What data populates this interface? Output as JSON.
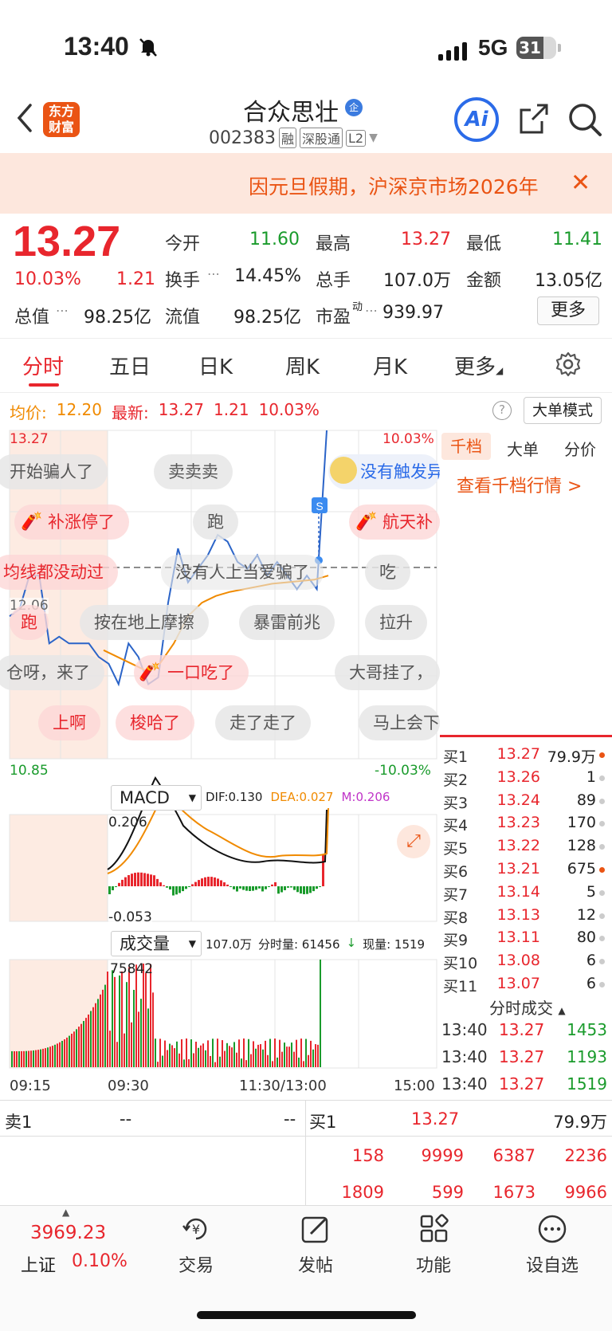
{
  "status": {
    "time": "13:40",
    "network": "5G",
    "battery": "31"
  },
  "header": {
    "logo": "东方财富",
    "stock_name": "合众思壮",
    "badge": "企",
    "code": "002383",
    "tags": [
      "融",
      "深股通",
      "L2"
    ],
    "ai": "Ai"
  },
  "notice": {
    "text": "因元旦假期，沪深京市场2026年",
    "close": "✕"
  },
  "quote": {
    "price": "13.27",
    "pct": "10.03%",
    "change": "1.21",
    "open_label": "今开",
    "open": "11.60",
    "high_label": "最高",
    "high": "13.27",
    "low_label": "最低",
    "low": "11.41",
    "turnover_label": "换手",
    "turnover": "14.45%",
    "volume_label": "总手",
    "volume": "107.0万",
    "amount_label": "金额",
    "amount": "13.05亿",
    "mktcap_label": "总值",
    "mktcap": "98.25亿",
    "float_label": "流值",
    "float": "98.25亿",
    "pe_label": "市盈",
    "pe_sup": "动",
    "pe": "939.97",
    "more": "更多"
  },
  "tabs": [
    "分时",
    "五日",
    "日K",
    "周K",
    "月K",
    "更多"
  ],
  "info": {
    "avg_label": "均价:",
    "avg": "12.20",
    "latest_label": "最新:",
    "latest": "13.27",
    "chg": "1.21",
    "pct": "10.03%",
    "big_order": "大单模式",
    "help": "?"
  },
  "chart_data": {
    "type": "line",
    "title": "",
    "y_top": "13.27",
    "y_mid": "12.06",
    "y_bottom": "10.85",
    "pct_top": "10.03%",
    "pct_bottom": "-10.03%",
    "x_labels": [
      "09:15",
      "09:30",
      "11:30/13:00",
      "15:00"
    ],
    "series": [
      {
        "values": [
          11.9,
          11.95,
          12.2,
          12.2,
          11.7,
          11.75,
          11.7,
          11.7,
          11.7,
          11.6,
          11.55,
          11.4,
          11.7,
          11.6,
          11.4,
          11.45,
          12.0,
          12.4,
          12.15,
          12.25,
          12.35,
          12.5,
          12.45,
          12.3,
          12.25,
          12.35,
          12.2,
          12.3,
          12.2,
          12.1,
          12.2,
          12.1,
          13.27
        ]
      },
      {
        "values": [
          11.65,
          11.6,
          11.55,
          11.5,
          11.55,
          11.7,
          11.9,
          12.0,
          12.05,
          12.08,
          12.1,
          12.12,
          12.14,
          12.15,
          12.16,
          12.17,
          12.2
        ]
      }
    ],
    "macd": {
      "dif": "DIF:0.130",
      "dea": "DEA:0.027",
      "m": "M:0.206",
      "top": "0.206",
      "bottom": "-0.053"
    },
    "volume": {
      "total": "107.0万",
      "fenshi": "分时量: 61456",
      "now": "现量: 1519",
      "max": "75842"
    }
  },
  "bullets": [
    {
      "text": "开始骗人了",
      "hot": false
    },
    {
      "text": "卖卖卖",
      "hot": false
    },
    {
      "text": "没有触发异",
      "hot": false
    },
    {
      "text": "补涨停了",
      "hot": true
    },
    {
      "text": "跑",
      "hot": false
    },
    {
      "text": "航天补",
      "hot": true
    },
    {
      "text": "均线都没动过",
      "hot": true
    },
    {
      "text": "没有人上当爱骗了",
      "hot": false
    },
    {
      "text": "吃",
      "hot": false
    },
    {
      "text": "跑",
      "hot": true
    },
    {
      "text": "按在地上摩擦",
      "hot": false
    },
    {
      "text": "暴雷前兆",
      "hot": false
    },
    {
      "text": "拉升",
      "hot": false
    },
    {
      "text": "仓呀，来了",
      "hot": false
    },
    {
      "text": "一口吃了",
      "hot": true
    },
    {
      "text": "大哥挂了，",
      "hot": false
    },
    {
      "text": "上啊",
      "hot": true
    },
    {
      "text": "梭哈了",
      "hot": true
    },
    {
      "text": "走了走了",
      "hot": false
    },
    {
      "text": "马上会下",
      "hot": false
    }
  ],
  "right_panel": {
    "tabs": [
      "千档",
      "大单",
      "分价"
    ],
    "link": "查看千档行情 >",
    "bids": [
      {
        "label": "买1",
        "price": "13.27",
        "vol": "79.9万"
      },
      {
        "label": "买2",
        "price": "13.26",
        "vol": "1"
      },
      {
        "label": "买3",
        "price": "13.24",
        "vol": "89"
      },
      {
        "label": "买4",
        "price": "13.23",
        "vol": "170"
      },
      {
        "label": "买5",
        "price": "13.22",
        "vol": "128"
      },
      {
        "label": "买6",
        "price": "13.21",
        "vol": "675"
      },
      {
        "label": "买7",
        "price": "13.14",
        "vol": "5"
      },
      {
        "label": "买8",
        "price": "13.13",
        "vol": "12"
      },
      {
        "label": "买9",
        "price": "13.11",
        "vol": "80"
      },
      {
        "label": "买10",
        "price": "13.08",
        "vol": "6"
      },
      {
        "label": "买11",
        "price": "13.07",
        "vol": "6"
      }
    ],
    "ticks_header": "分时成交",
    "ticks": [
      {
        "time": "13:40",
        "price": "13.27",
        "vol": "1453"
      },
      {
        "time": "13:40",
        "price": "13.27",
        "vol": "1193"
      },
      {
        "time": "13:40",
        "price": "13.27",
        "vol": "1519"
      }
    ]
  },
  "indicators": {
    "macd": "MACD",
    "volume": "成交量"
  },
  "order_book": {
    "sell1_label": "卖1",
    "sell1_price": "--",
    "sell1_vol": "--",
    "buy1_label": "买1",
    "buy1_price": "13.27",
    "buy1_vol": "79.9万",
    "row1": [
      "158",
      "9999",
      "6387",
      "2236"
    ],
    "row2": [
      "1809",
      "599",
      "1673",
      "9966"
    ]
  },
  "bottom_nav": {
    "index_value": "3969.23",
    "index_name": "上证",
    "index_pct": "0.10%",
    "items": [
      "交易",
      "发帖",
      "功能",
      "设自选"
    ]
  }
}
